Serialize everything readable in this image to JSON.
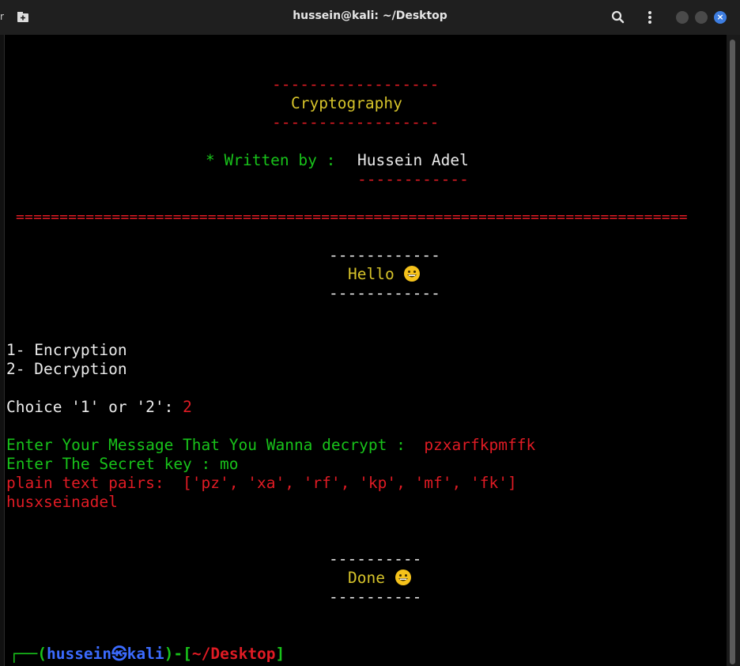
{
  "window": {
    "title": "hussein@kali: ~/Desktop",
    "corner_glyph": "r",
    "close_glyph": "×"
  },
  "terminal": {
    "dashes_top_banner": "------------------",
    "banner_title": "Cryptography",
    "dashes_bottom_banner": "------------------",
    "written_by_label": "* Written by :",
    "author": "Hussein Adel",
    "author_underline": "------------",
    "separator": "=============================================================================",
    "hello_dashes_top": "------------",
    "hello_text": "Hello",
    "hello_dashes_bottom": "------------",
    "menu_option_1": "1- Encryption",
    "menu_option_2": "2- Decryption",
    "choice_prompt": "Choice '1' or '2': ",
    "choice_value": "2",
    "message_prompt": "Enter Your Message That You Wanna decrypt :  ",
    "message_value": "pzxarfkpmffk",
    "key_prompt": "Enter The Secret key : ",
    "key_value": "mo",
    "pairs_line": "plain text pairs:  ['pz', 'xa', 'rf', 'kp', 'mf', 'fk']",
    "plain_text_result": "husxseinadel",
    "done_dashes_top": "----------",
    "done_text": "Done",
    "done_dashes_bottom": "----------",
    "prompt": {
      "corner": "┌──(",
      "user": "hussein",
      "at_symbol": "㉿",
      "host": "kali",
      "mid": ")-[",
      "path": "~/Desktop",
      "end": "]"
    }
  },
  "colors": {
    "red": "#e01b24",
    "yellow": "#d6c32a",
    "green": "#18c21a",
    "blue": "#3b6bff",
    "close_button": "#3d7de0"
  }
}
